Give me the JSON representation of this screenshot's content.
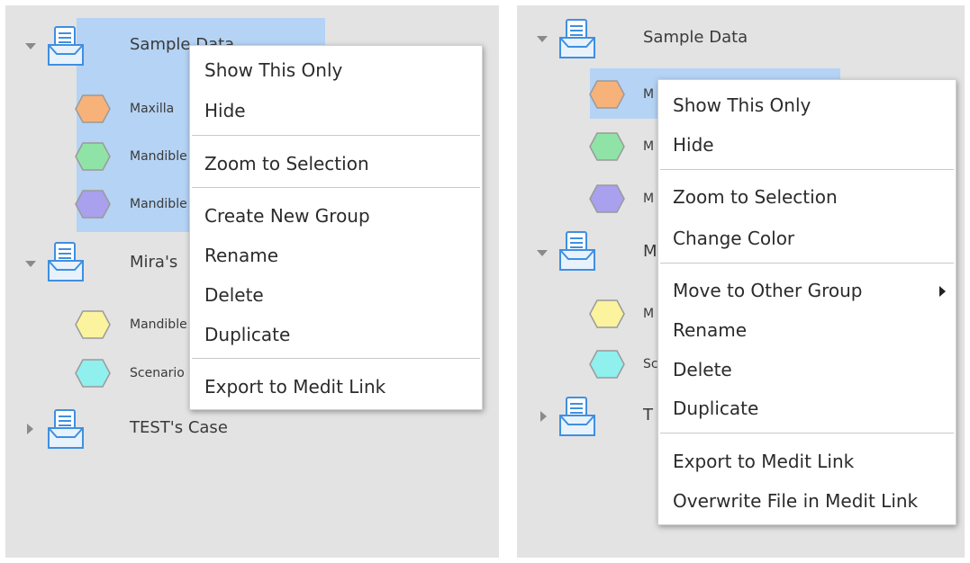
{
  "left": {
    "tree": {
      "group_sample": "Sample Data",
      "item_maxilla": "Maxilla",
      "item_mandible_1": "Mandible",
      "item_mandible_2": "Mandible",
      "group_mira": "Mira's",
      "item_mandible_3": "Mandible",
      "item_scenario": "Scenario",
      "group_test": "TEST's Case"
    },
    "menu": {
      "show_this_only": "Show This Only",
      "hide": "Hide",
      "zoom_to_selection": "Zoom to Selection",
      "create_new_group": "Create New Group",
      "rename": "Rename",
      "delete": "Delete",
      "duplicate": "Duplicate",
      "export_to_medit_link": "Export to Medit Link"
    }
  },
  "right": {
    "tree": {
      "group_sample": "Sample Data",
      "item_1": "M",
      "item_2": "M",
      "item_3": "M",
      "group_2": "M",
      "item_4": "M",
      "item_5": "Sc",
      "group_3": "T"
    },
    "menu": {
      "show_this_only": "Show This Only",
      "hide": "Hide",
      "zoom_to_selection": "Zoom to Selection",
      "change_color": "Change Color",
      "move_to_other_group": "Move to Other Group",
      "rename": "Rename",
      "delete": "Delete",
      "duplicate": "Duplicate",
      "export_to_medit_link": "Export to Medit Link",
      "overwrite_file": "Overwrite File in Medit Link"
    }
  },
  "colors": {
    "panel_bg": "#e3e3e3",
    "selection": "#b5d3f4",
    "folder_blue": "#3f8fe0",
    "hex_orange": "#f7b27a",
    "hex_green": "#8fe3a6",
    "hex_purple": "#a9a0ee",
    "hex_yellow": "#fbf39e",
    "hex_cyan": "#8ff0ee"
  }
}
